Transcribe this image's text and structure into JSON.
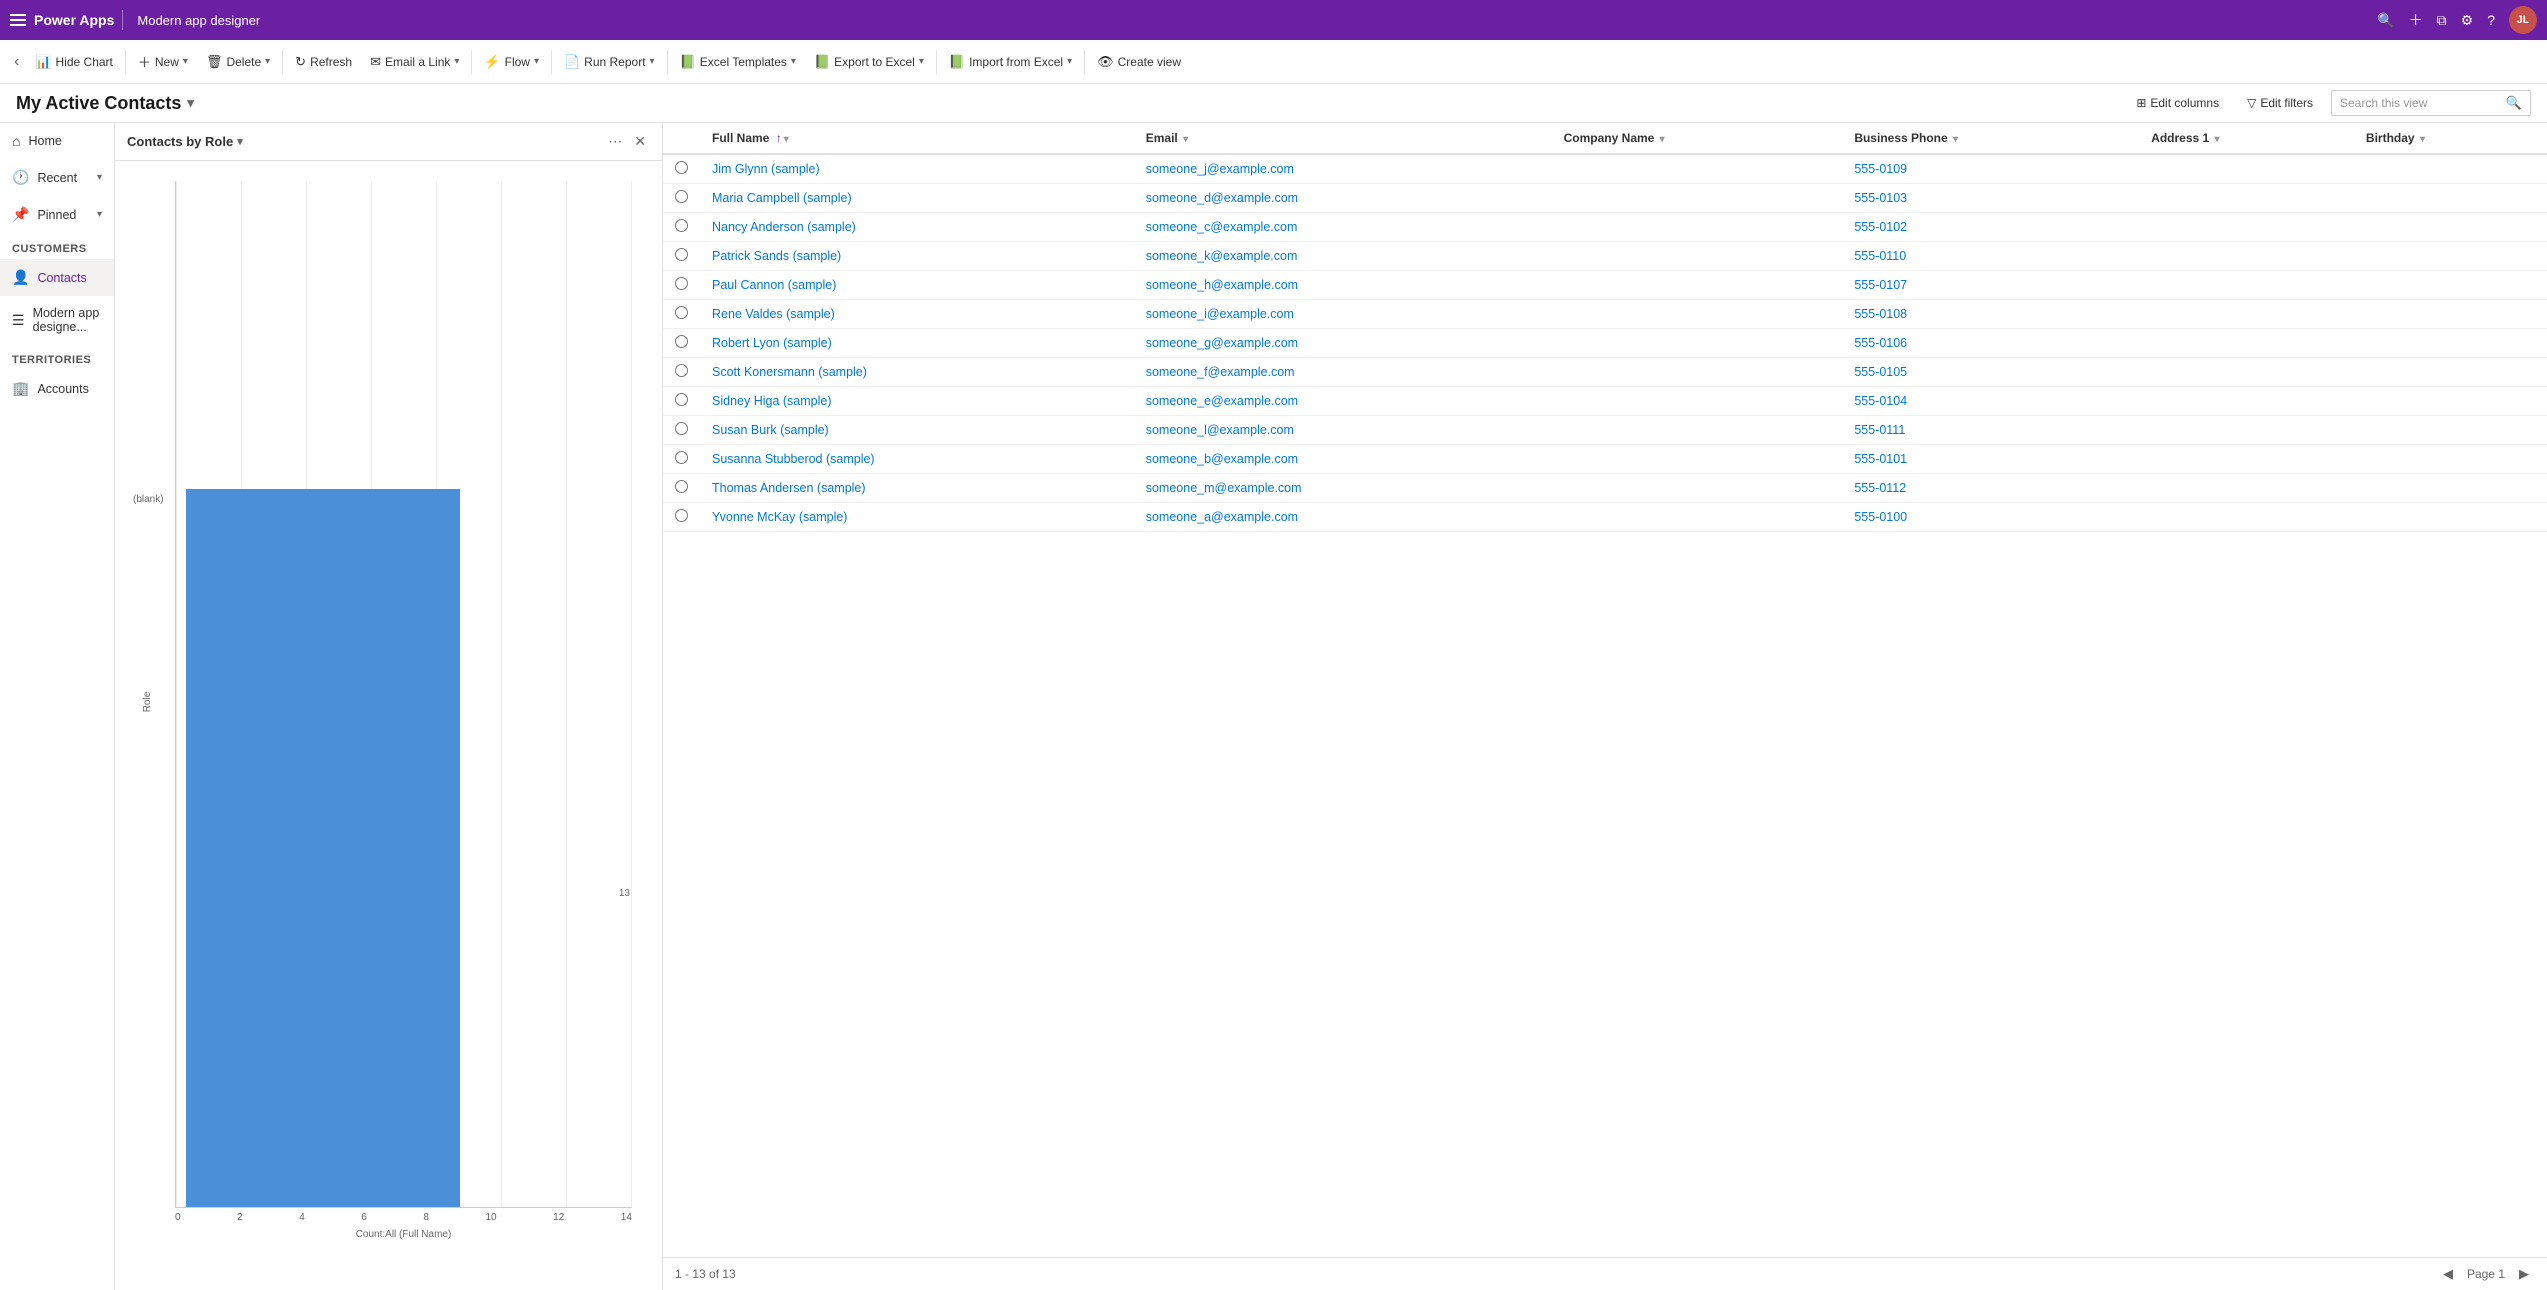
{
  "app": {
    "name": "Power Apps",
    "page_title": "Modern app designer",
    "avatar_initials": "JL"
  },
  "toolbar": {
    "back_label": "‹",
    "hide_chart_label": "Hide Chart",
    "new_label": "New",
    "delete_label": "Delete",
    "refresh_label": "Refresh",
    "email_link_label": "Email a Link",
    "flow_label": "Flow",
    "run_report_label": "Run Report",
    "excel_templates_label": "Excel Templates",
    "export_excel_label": "Export to Excel",
    "import_excel_label": "Import from Excel",
    "create_view_label": "Create view"
  },
  "view_header": {
    "title": "My Active Contacts",
    "edit_columns_label": "Edit columns",
    "edit_filters_label": "Edit filters",
    "search_placeholder": "Search this view"
  },
  "sidebar": {
    "home_label": "Home",
    "recent_label": "Recent",
    "pinned_label": "Pinned",
    "customers_section": "Customers",
    "contacts_label": "Contacts",
    "modern_app_label": "Modern app designe...",
    "territories_section": "Territories",
    "accounts_label": "Accounts"
  },
  "chart": {
    "title": "Contacts by Role",
    "blank_label": "(blank)",
    "role_label": "Role",
    "bar_value": 13,
    "x_axis_label": "Count:All (Full Name)",
    "x_ticks": [
      "0",
      "2",
      "4",
      "6",
      "8",
      "10",
      "12",
      "14"
    ]
  },
  "table": {
    "columns": [
      {
        "label": "Full Name",
        "sort": "↑",
        "arrow": "▾"
      },
      {
        "label": "Email",
        "arrow": "▾"
      },
      {
        "label": "Company Name",
        "arrow": "▾"
      },
      {
        "label": "Business Phone",
        "arrow": "▾"
      },
      {
        "label": "Address 1",
        "arrow": "▾"
      },
      {
        "label": "Birthday",
        "arrow": "▾"
      }
    ],
    "rows": [
      {
        "full_name": "Jim Glynn (sample)",
        "email": "someone_j@example.com",
        "company": "",
        "phone": "555-0109",
        "address": "",
        "birthday": ""
      },
      {
        "full_name": "Maria Campbell (sample)",
        "email": "someone_d@example.com",
        "company": "",
        "phone": "555-0103",
        "address": "",
        "birthday": ""
      },
      {
        "full_name": "Nancy Anderson (sample)",
        "email": "someone_c@example.com",
        "company": "",
        "phone": "555-0102",
        "address": "",
        "birthday": ""
      },
      {
        "full_name": "Patrick Sands (sample)",
        "email": "someone_k@example.com",
        "company": "",
        "phone": "555-0110",
        "address": "",
        "birthday": ""
      },
      {
        "full_name": "Paul Cannon (sample)",
        "email": "someone_h@example.com",
        "company": "",
        "phone": "555-0107",
        "address": "",
        "birthday": ""
      },
      {
        "full_name": "Rene Valdes (sample)",
        "email": "someone_i@example.com",
        "company": "",
        "phone": "555-0108",
        "address": "",
        "birthday": ""
      },
      {
        "full_name": "Robert Lyon (sample)",
        "email": "someone_g@example.com",
        "company": "",
        "phone": "555-0106",
        "address": "",
        "birthday": ""
      },
      {
        "full_name": "Scott Konersmann (sample)",
        "email": "someone_f@example.com",
        "company": "",
        "phone": "555-0105",
        "address": "",
        "birthday": ""
      },
      {
        "full_name": "Sidney Higa (sample)",
        "email": "someone_e@example.com",
        "company": "",
        "phone": "555-0104",
        "address": "",
        "birthday": ""
      },
      {
        "full_name": "Susan Burk (sample)",
        "email": "someone_l@example.com",
        "company": "",
        "phone": "555-0111",
        "address": "",
        "birthday": ""
      },
      {
        "full_name": "Susanna Stubberod (sample)",
        "email": "someone_b@example.com",
        "company": "",
        "phone": "555-0101",
        "address": "",
        "birthday": ""
      },
      {
        "full_name": "Thomas Andersen (sample)",
        "email": "someone_m@example.com",
        "company": "",
        "phone": "555-0112",
        "address": "",
        "birthday": ""
      },
      {
        "full_name": "Yvonne McKay (sample)",
        "email": "someone_a@example.com",
        "company": "",
        "phone": "555-0100",
        "address": "",
        "birthday": ""
      }
    ],
    "footer": {
      "record_count": "1 - 13 of 13",
      "page_label": "Page 1"
    }
  }
}
